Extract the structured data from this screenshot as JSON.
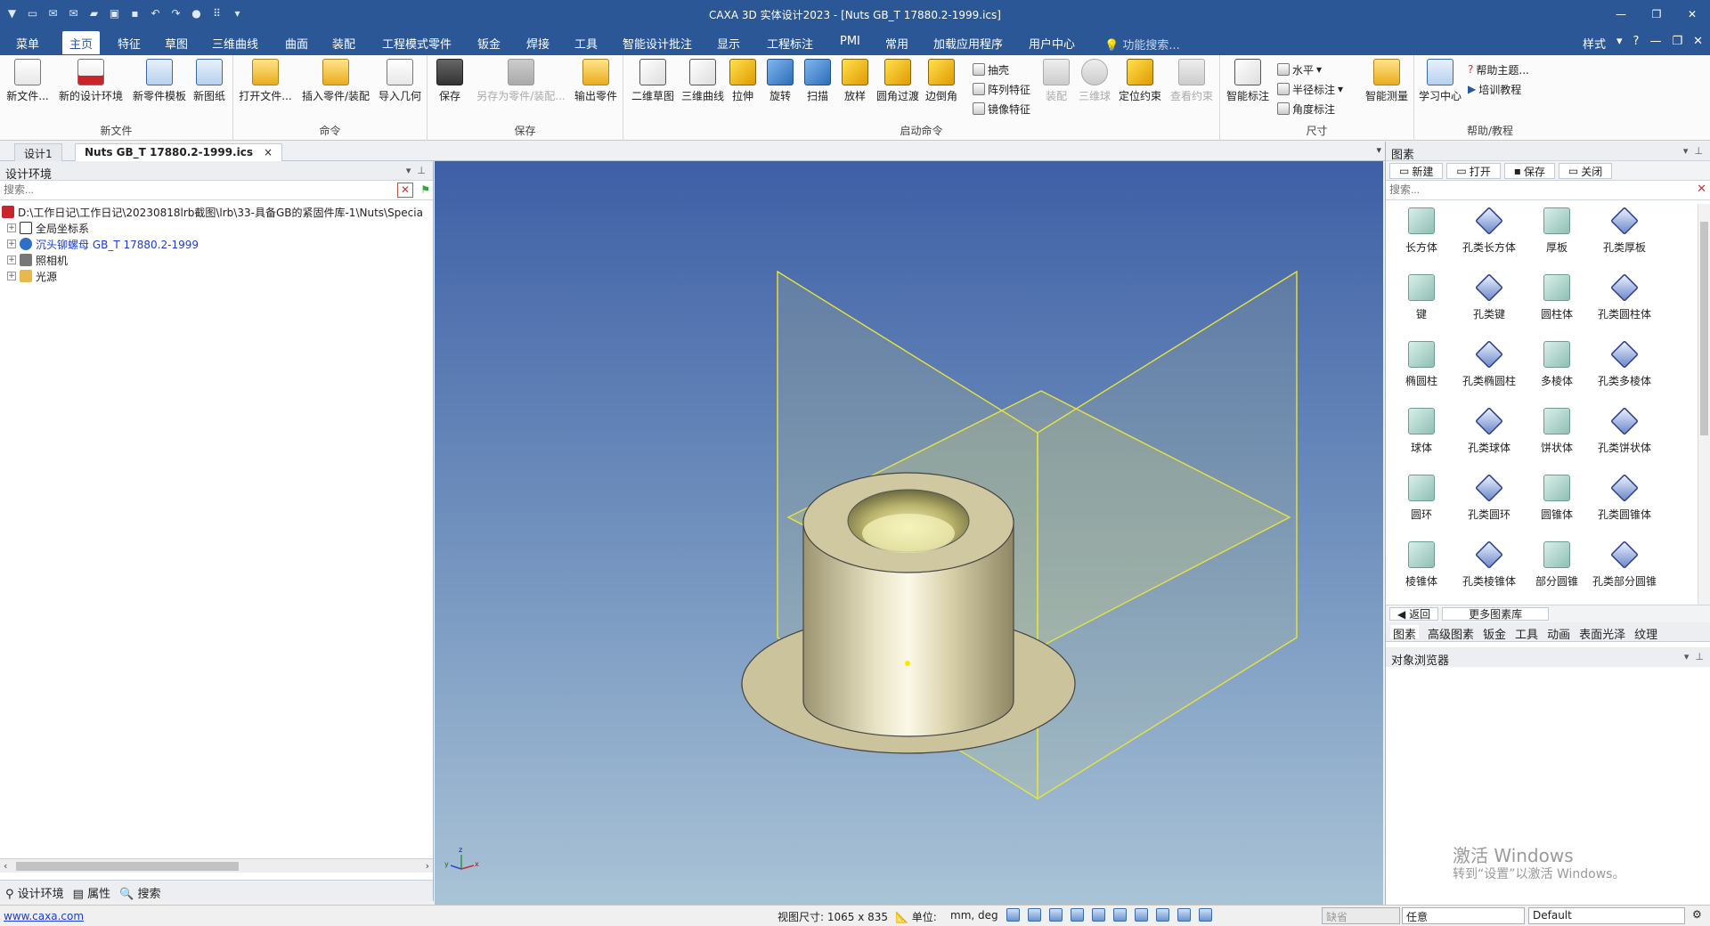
{
  "window": {
    "title": "CAXA 3D 实体设计2023 - [Nuts GB_T 17880.2-1999.ics]"
  },
  "menu_tabs": [
    "菜单",
    "主页",
    "特征",
    "草图",
    "三维曲线",
    "曲面",
    "装配",
    "工程模式零件",
    "钣金",
    "焊接",
    "工具",
    "智能设计批注",
    "显示",
    "工程标注",
    "PMI",
    "常用",
    "加载应用程序",
    "用户中心"
  ],
  "function_search": "功能搜索...",
  "style_label": "样式",
  "ribbon": {
    "new_file": {
      "title": "新文件",
      "buttons": [
        "新文件...",
        "新的设计环境",
        "新零件模板",
        "新图纸"
      ]
    },
    "command": {
      "title": "命令",
      "buttons": [
        "打开文件...",
        "插入零件/装配",
        "导入几何"
      ]
    },
    "save": {
      "title": "保存",
      "buttons": [
        "保存",
        "另存为零件/装配...",
        "输出零件"
      ]
    },
    "launch": {
      "title": "启动命令",
      "buttons": [
        "二维草图",
        "三维曲线",
        "拉伸",
        "旋转",
        "扫描",
        "放样",
        "圆角过渡",
        "边倒角"
      ],
      "small": [
        "抽壳",
        "阵列特征",
        "镜像特征"
      ],
      "disabled": [
        "装配",
        "三维球",
        "定位约束",
        "查看约束"
      ]
    },
    "dimension": {
      "title": "尺寸",
      "smart": "智能标注",
      "small": [
        "水平",
        "半径标注",
        "角度标注"
      ],
      "measure": "智能测量"
    },
    "help": {
      "title": "帮助/教程",
      "center": "学习中心",
      "small": [
        "帮助主题...",
        "培训教程"
      ]
    }
  },
  "doc_tabs": [
    "设计1",
    "Nuts GB_T 17880.2-1999.ics"
  ],
  "left_panel": {
    "title": "设计环境",
    "search_placeholder": "搜索...",
    "tree": [
      {
        "text": "D:\\工作日记\\工作日记\\20230818lrb截图\\lrb\\33-具备GB的紧固件库-1\\Nuts\\Specia",
        "link": false
      },
      {
        "text": "全局坐标系",
        "link": false
      },
      {
        "text": "沉头铆螺母 GB_T 17880.2-1999",
        "link": true
      },
      {
        "text": "照相机",
        "link": false
      },
      {
        "text": "光源",
        "link": false
      }
    ],
    "tabs": [
      "设计环境",
      "属性",
      "搜索"
    ]
  },
  "right_panel": {
    "title": "图素",
    "tools": [
      "新建",
      "打开",
      "保存",
      "关闭"
    ],
    "search_placeholder": "搜索...",
    "items": [
      "长方体",
      "孔类长方体",
      "厚板",
      "孔类厚板",
      "键",
      "孔类键",
      "圆柱体",
      "孔类圆柱体",
      "椭圆柱",
      "孔类椭圆柱",
      "多棱体",
      "孔类多棱体",
      "球体",
      "孔类球体",
      "饼状体",
      "孔类饼状体",
      "圆环",
      "孔类圆环",
      "圆锥体",
      "孔类圆锥体",
      "棱锥体",
      "孔类棱锥体",
      "部分圆锥",
      "孔类部分圆锥"
    ],
    "back": "返回",
    "more": "更多图素库",
    "tabs": [
      "图素",
      "高级图素",
      "钣金",
      "工具",
      "动画",
      "表面光泽",
      "纹理"
    ],
    "object_browser": "对象浏览器"
  },
  "watermark": {
    "line1": "激活 Windows",
    "line2": "转到“设置”以激活 Windows。"
  },
  "status": {
    "url": "www.caxa.com",
    "view_size": "视图尺寸: 1065 x 835",
    "unit_label": "单位:",
    "unit_value": "mm, deg",
    "filter_disabled": "缺省",
    "filter": "任意",
    "style": "Default"
  },
  "colors": {
    "titlebar": "#2b5797",
    "viewport_top": "#3e5fa6",
    "viewport_bottom": "#a9c3d6",
    "part": "#cdc49a"
  }
}
